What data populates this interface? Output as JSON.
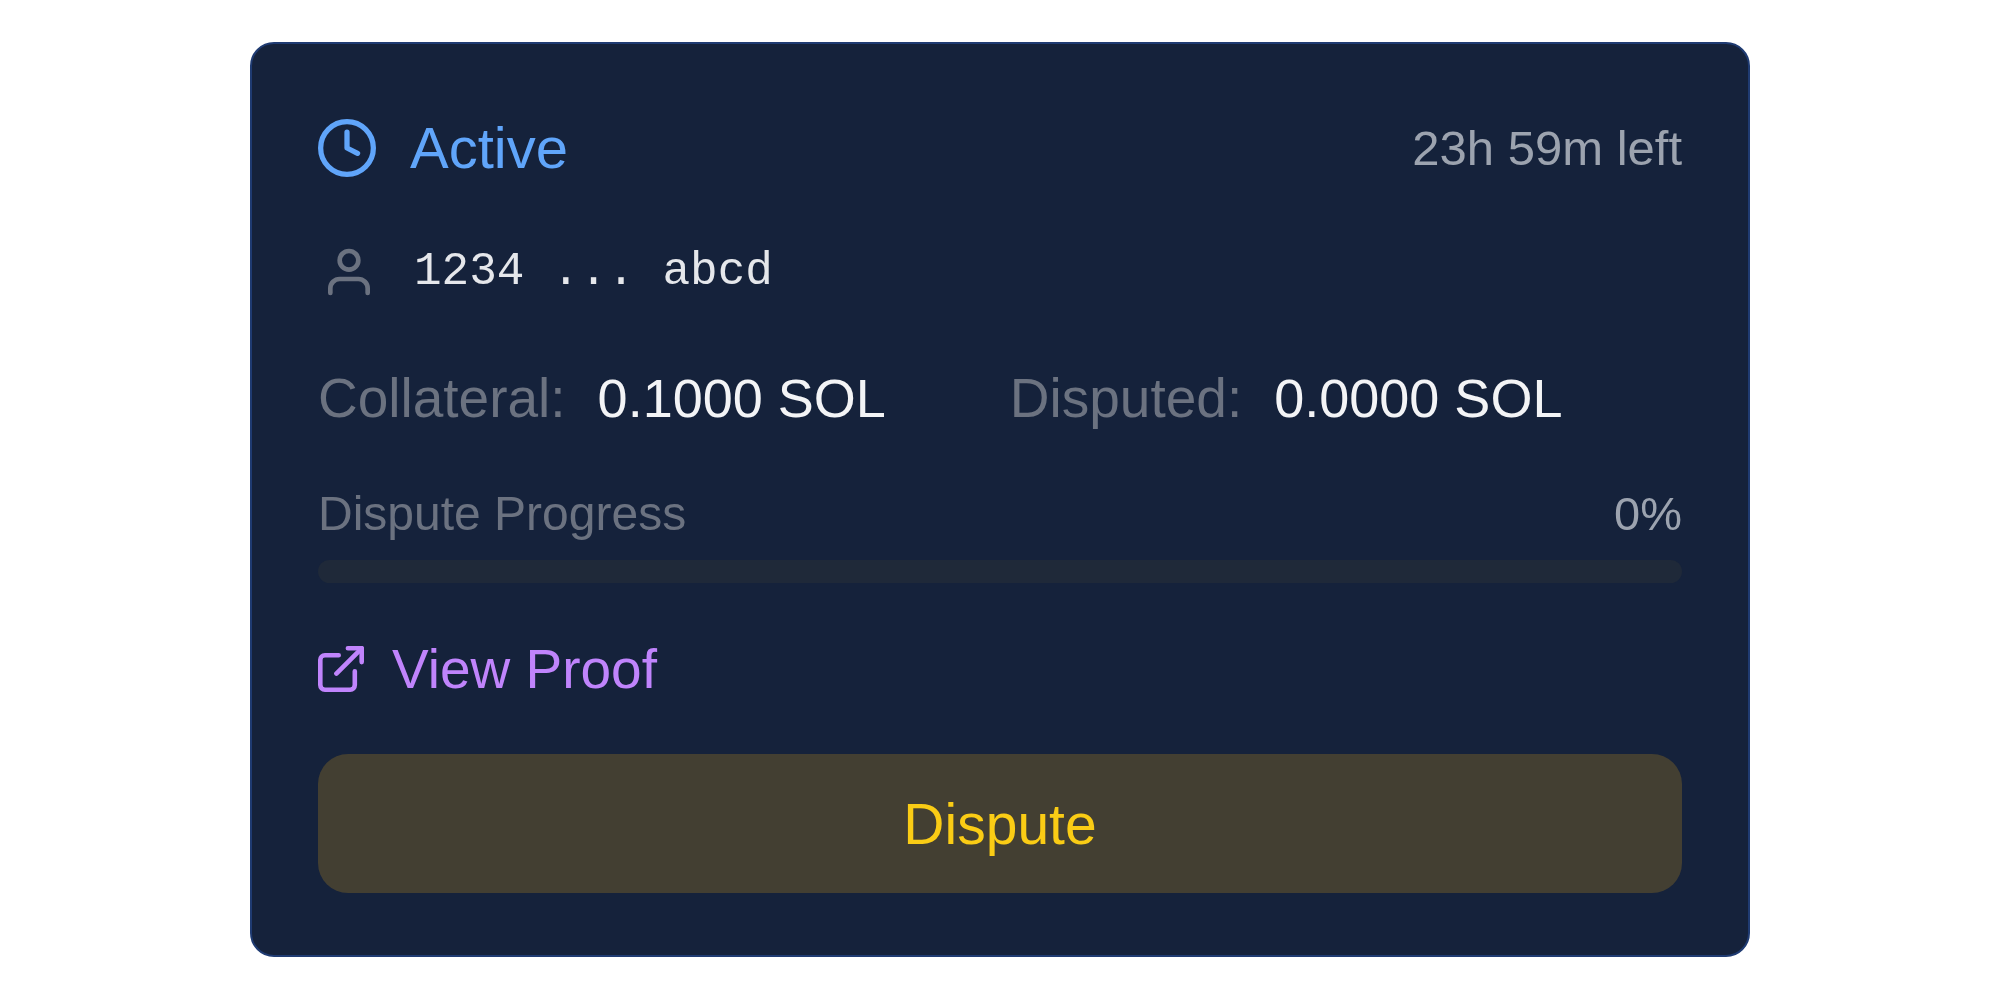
{
  "card": {
    "status": {
      "label": "Active",
      "kind": "active"
    },
    "time_left": "23h 59m left",
    "address": "1234 ... abcd",
    "stats": [
      {
        "label": "Collateral:",
        "value": "0.1000 SOL"
      },
      {
        "label": "Disputed:",
        "value": "0.0000 SOL"
      }
    ],
    "progress": {
      "label": "Dispute Progress",
      "reading": "0%",
      "level": 0
    },
    "link": {
      "label": "View Proof"
    },
    "button": {
      "label": "Dispute"
    }
  }
}
